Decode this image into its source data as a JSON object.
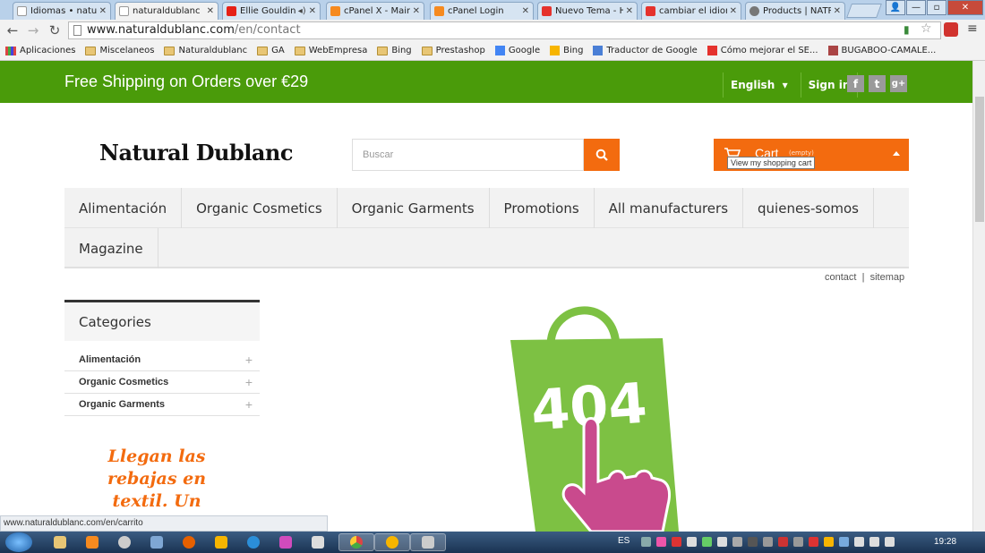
{
  "browser": {
    "tabs": [
      {
        "title": "Idiomas • naturald",
        "icon_color": "#ffffff"
      },
      {
        "title": "naturaldublanc",
        "icon_color": "#ffffff",
        "active": true
      },
      {
        "title": "Ellie Goulding",
        "icon_color": "#e62117"
      },
      {
        "title": "cPanel X - Main",
        "icon_color": "#f68a1f"
      },
      {
        "title": "cPanel Login",
        "icon_color": "#f68a1f"
      },
      {
        "title": "Nuevo Tema - H",
        "icon_color": "#e5322d"
      },
      {
        "title": "cambiar el idioma",
        "icon_color": "#e5322d"
      },
      {
        "title": "Products | NATR",
        "icon_color": "#777777"
      }
    ],
    "url_host": "www.naturaldublanc.com",
    "url_path": "/en/contact",
    "bookmarks": [
      {
        "label": "Aplicaciones",
        "icon": "apps-icon"
      },
      {
        "label": "Miscelaneos",
        "icon": "folder-icon"
      },
      {
        "label": "Naturaldublanc",
        "icon": "folder-icon"
      },
      {
        "label": "GA",
        "icon": "folder-icon"
      },
      {
        "label": "WebEmpresa",
        "icon": "folder-icon"
      },
      {
        "label": "Bing",
        "icon": "folder-icon"
      },
      {
        "label": "Prestashop",
        "icon": "folder-icon"
      },
      {
        "label": "Google",
        "icon": "google-icon"
      },
      {
        "label": "Bing",
        "icon": "bing-icon"
      },
      {
        "label": "Traductor de Google",
        "icon": "translate-icon"
      },
      {
        "label": "Cómo mejorar el SE...",
        "icon": "bookmark-icon"
      },
      {
        "label": "BUGABOO-CAMALE...",
        "icon": "home-icon"
      }
    ],
    "status_url": "www.naturaldublanc.com/en/carrito"
  },
  "site": {
    "promo": "Free Shipping on Orders over €29",
    "language": "English",
    "signin": "Sign in",
    "social": [
      "f",
      "t",
      "g+"
    ],
    "logo": "Natural Dublanc",
    "search_placeholder": "Buscar",
    "cart_label": "Cart",
    "cart_status": "(empty)",
    "cart_tooltip": "View my shopping cart",
    "menu_row1": [
      "Alimentación",
      "Organic Cosmetics",
      "Organic Garments",
      "Promotions",
      "All manufacturers",
      "quienes-somos"
    ],
    "menu_row2": [
      "Magazine"
    ],
    "contact_link": "contact",
    "sitemap_link": "sitemap",
    "categories_title": "Categories",
    "categories": [
      "Alimentación",
      "Organic Cosmetics",
      "Organic Garments"
    ],
    "banner_lines": [
      "Llegan las",
      "rebajas en",
      "textil. Un"
    ],
    "error_code": "404",
    "colors": {
      "brand_green": "#4a9b0a",
      "accent_orange": "#f36b0f",
      "bag_green": "#7dc143",
      "hand_pink": "#c94a8d"
    }
  },
  "taskbar": {
    "language": "ES",
    "clock": "19:28"
  }
}
